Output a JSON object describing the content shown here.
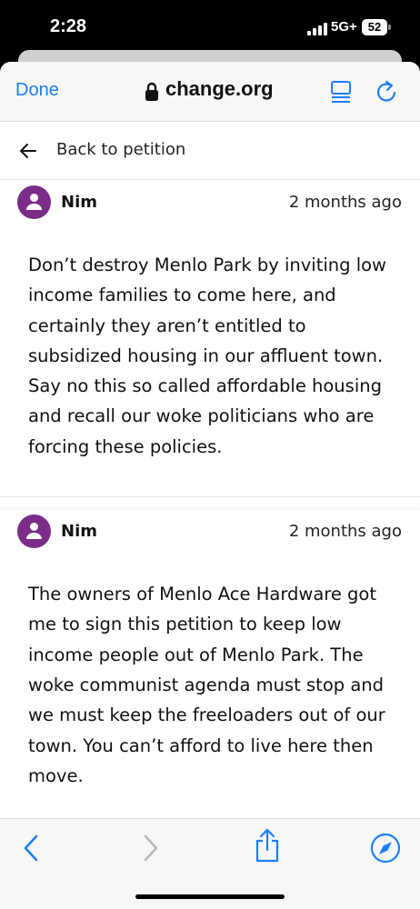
{
  "status": {
    "time": "2:28",
    "network": "5G+",
    "battery": "52"
  },
  "browser": {
    "done_label": "Done",
    "url": "change.org"
  },
  "page": {
    "back_label": "Back to petition"
  },
  "comments": [
    {
      "author": "Nim",
      "time": "2 months ago",
      "text": "Don’t destroy Menlo Park by inviting low income families to come here, and certainly they aren’t entitled to subsidized housing in our affluent town. Say no this so called affordable housing and recall our woke politicians who are forcing these policies."
    },
    {
      "author": "Nim",
      "time": "2 months ago",
      "text": "The owners of Menlo Ace Hardware got me to sign this petition to keep low income people out of Menlo Park. The woke communist agenda must stop and we must keep the freeloaders out of our town. You can’t afford to live here then move."
    }
  ],
  "icons": {
    "lock": "lock-icon",
    "reader": "reader-mode-icon",
    "reload": "reload-icon",
    "back": "arrow-left-icon",
    "toolbar_back": "chevron-left-icon",
    "toolbar_forward": "chevron-right-icon",
    "share": "share-icon",
    "safari": "compass-icon",
    "avatar": "person-icon"
  },
  "colors": {
    "accent": "#1c7ef6",
    "avatar": "#7b2c88",
    "disabled": "#b8b8b8"
  }
}
